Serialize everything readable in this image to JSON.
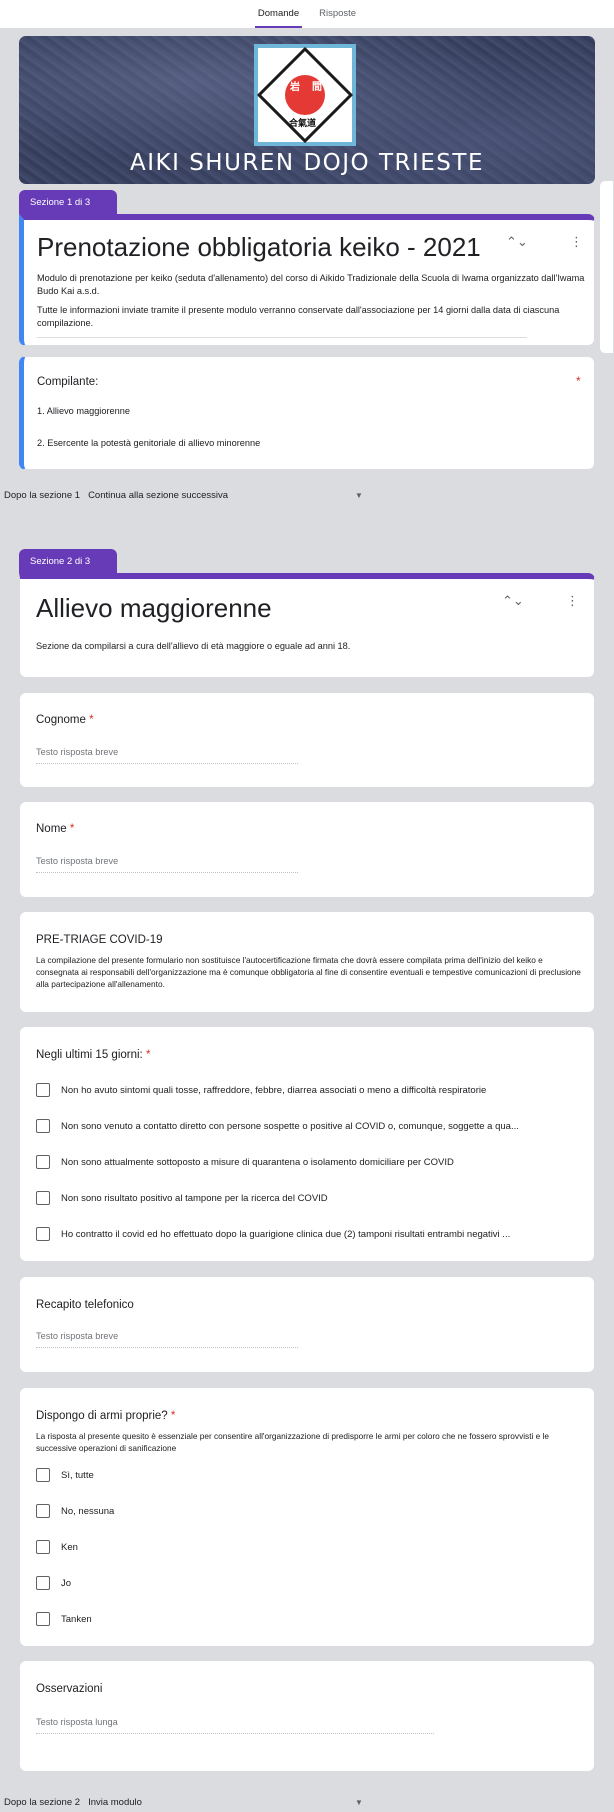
{
  "tabs": [
    {
      "label": "Domande",
      "active": true
    },
    {
      "label": "Risposte",
      "active": false
    }
  ],
  "banner": {
    "title": "AIKI SHUREN DOJO TRIESTE",
    "logo_text": [
      "岩",
      "間",
      "合氣道"
    ]
  },
  "section1": {
    "tab": "Sezione 1 di 3",
    "title": "Prenotazione obbligatoria keiko - 2021",
    "desc1": "Modulo di prenotazione per keiko (seduta d'allenamento) del corso di Aikido Tradizionale della Scuola di Iwama organizzato dall'Iwama Budo Kai a.s.d.",
    "desc2": "Tutte le informazioni inviate tramite il presente modulo verranno conservate dall'associazione per 14 giorni dalla data di ciascuna compilazione.",
    "compilante": {
      "title": "Compilante:",
      "options": [
        "1.  Allievo maggiorenne",
        "2.  Esercente la potestà genitoriale di allievo minorenne"
      ]
    },
    "after_label": "Dopo la sezione 1",
    "after_value": "Continua alla sezione successiva"
  },
  "section2": {
    "tab": "Sezione 2 di 3",
    "title": "Allievo maggiorenne",
    "desc": "Sezione da compilarsi a cura dell'allievo di età maggiore o eguale ad anni 18.",
    "cognome": {
      "title": "Cognome",
      "placeholder": "Testo risposta breve"
    },
    "nome": {
      "title": "Nome",
      "placeholder": "Testo risposta breve"
    },
    "pretriage": {
      "title": "PRE-TRIAGE COVID-19",
      "desc": "La compilazione del presente formulario non sostituisce l'autocertificazione firmata che dovrà essere compilata prima dell'inizio del keiko e consegnata ai responsabili dell'organizzazione ma è comunque obbligatoria al fine di consentire eventuali e tempestive comunicazioni di preclusione alla partecipazione all'allenamento."
    },
    "ultimi15": {
      "title": "Negli ultimi 15 giorni:",
      "options": [
        "Non ho avuto sintomi quali tosse, raffreddore, febbre, diarrea associati o meno a difficoltà respiratorie",
        "Non sono venuto a contatto diretto con persone sospette o positive al COVID o, comunque, soggette a qua...",
        "Non sono attualmente sottoposto a misure di quarantena o isolamento domiciliare per COVID",
        "Non sono risultato positivo al tampone per la ricerca del COVID",
        "Ho contratto il covid ed ho effettuato dopo la guarigione clinica due (2) tamponi risultati entrambi negativi ..."
      ]
    },
    "recapito": {
      "title": "Recapito telefonico",
      "placeholder": "Testo risposta breve"
    },
    "armi": {
      "title": "Dispongo di armi proprie?",
      "desc": "La risposta al presente quesito è essenziale per consentire all'organizzazione di predisporre le armi per coloro che ne fossero sprovvisti e le successive operazioni di sanificazione",
      "options": [
        "Sì, tutte",
        "No, nessuna",
        "Ken",
        "Jo",
        "Tanken"
      ]
    },
    "osservazioni": {
      "title": "Osservazioni",
      "placeholder": "Testo risposta lunga"
    },
    "after_label": "Dopo la sezione 2",
    "after_value": "Invia modulo"
  }
}
